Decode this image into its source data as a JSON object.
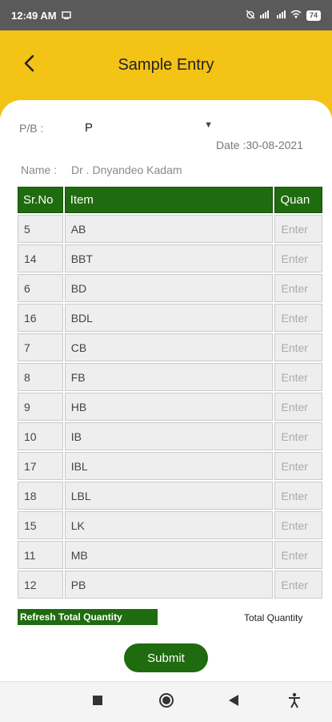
{
  "status_bar": {
    "time": "12:49 AM",
    "battery": "74"
  },
  "header": {
    "title": "Sample Entry"
  },
  "form": {
    "pb_label": "P/B :",
    "pb_value": "P",
    "date": "Date :30-08-2021",
    "name_label": "Name :",
    "name_value": "Dr . Dnyandeo Kadam"
  },
  "table": {
    "columns": [
      "Sr.No",
      "Item",
      "Quan"
    ],
    "qty_placeholder": "Enter",
    "rows": [
      {
        "sr": "5",
        "item": "AB"
      },
      {
        "sr": "14",
        "item": "BBT"
      },
      {
        "sr": "6",
        "item": "BD"
      },
      {
        "sr": "16",
        "item": "BDL"
      },
      {
        "sr": "7",
        "item": "CB"
      },
      {
        "sr": "8",
        "item": "FB"
      },
      {
        "sr": "9",
        "item": "HB"
      },
      {
        "sr": "10",
        "item": "IB"
      },
      {
        "sr": "17",
        "item": "IBL"
      },
      {
        "sr": "18",
        "item": "LBL"
      },
      {
        "sr": "15",
        "item": "LK"
      },
      {
        "sr": "11",
        "item": "MB"
      },
      {
        "sr": "12",
        "item": "PB"
      }
    ]
  },
  "actions": {
    "refresh_label": "Refresh Total Quantity",
    "total_label": "Total Quantity",
    "submit_label": "Submit"
  },
  "icons": {
    "back": "back-arrow-icon",
    "dropdown": "caret-down-icon",
    "nav": [
      "stop-square-icon",
      "home-circle-icon",
      "back-triangle-icon",
      "accessibility-icon"
    ]
  },
  "colors": {
    "header": "#f3c316",
    "accent": "#1f6b0f",
    "status_bar": "#5a5a5a"
  }
}
